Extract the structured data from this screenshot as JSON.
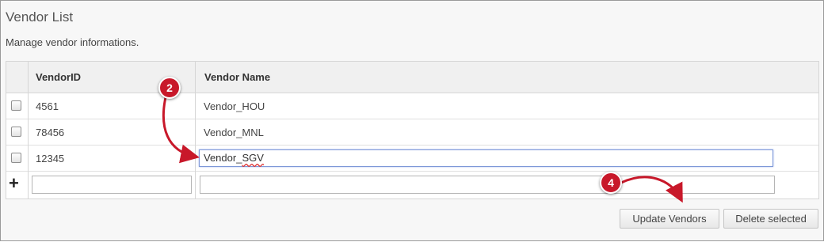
{
  "page": {
    "title": "Vendor List",
    "subtitle": "Manage vendor informations."
  },
  "table": {
    "columns": [
      "VendorID",
      "Vendor Name"
    ],
    "rows": [
      {
        "vendor_id": "4561",
        "vendor_name": "Vendor_HOU",
        "checked": false
      },
      {
        "vendor_id": "78456",
        "vendor_name": "Vendor_MNL",
        "checked": false
      },
      {
        "vendor_id": "12345",
        "vendor_name_prefix": "Vendor_",
        "vendor_name_misspelled": "SGV",
        "checked": false
      }
    ],
    "add_row": {
      "icon": "plus-icon",
      "vendor_id_value": "",
      "vendor_name_value": ""
    }
  },
  "buttons": {
    "update": "Update Vendors",
    "delete": "Delete selected"
  },
  "annotations": [
    {
      "number": "2",
      "icon": "step-badge"
    },
    {
      "number": "4",
      "icon": "step-badge"
    }
  ],
  "colors": {
    "badge": "#c8182a",
    "focus_border": "#7e98d8"
  }
}
